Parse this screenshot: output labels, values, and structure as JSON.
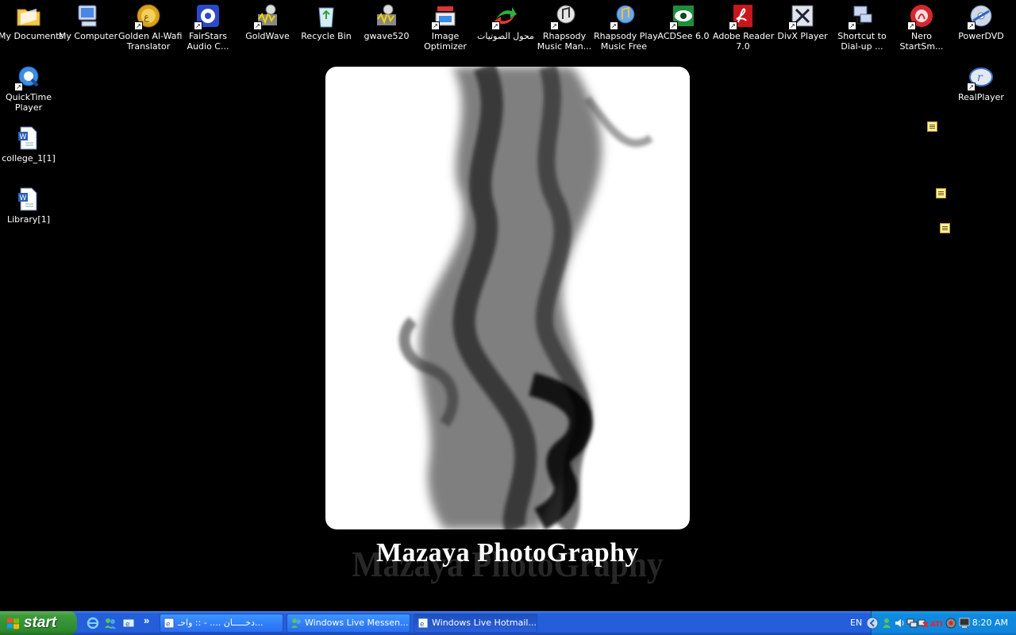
{
  "desktop": {
    "icons_top": [
      {
        "name": "my-documents",
        "l1": "My Documents",
        "l2": ""
      },
      {
        "name": "my-computer",
        "l1": "My Computer",
        "l2": ""
      },
      {
        "name": "golden-al-wafi",
        "l1": "Golden Al-Wafi",
        "l2": "Translator"
      },
      {
        "name": "fairstars",
        "l1": "FairStars",
        "l2": "Audio C..."
      },
      {
        "name": "goldwave",
        "l1": "GoldWave",
        "l2": ""
      },
      {
        "name": "recycle-bin",
        "l1": "Recycle Bin",
        "l2": ""
      },
      {
        "name": "gwave520",
        "l1": "gwave520",
        "l2": ""
      },
      {
        "name": "image-optimizer",
        "l1": "Image",
        "l2": "Optimizer"
      },
      {
        "name": "arabic-converter",
        "l1": "محول الصوتيات",
        "l2": ""
      },
      {
        "name": "rhapsody-music-manager",
        "l1": "Rhapsody",
        "l2": "Music Man..."
      },
      {
        "name": "rhapsody-play",
        "l1": "Rhapsody Play",
        "l2": "Music Free"
      },
      {
        "name": "acdsee",
        "l1": "ACDSee 6.0",
        "l2": ""
      },
      {
        "name": "adobe-reader",
        "l1": "Adobe Reader",
        "l2": "7.0"
      },
      {
        "name": "divx-player",
        "l1": "DivX Player",
        "l2": ""
      },
      {
        "name": "dialup-shortcut",
        "l1": "Shortcut to",
        "l2": "Dial-up ..."
      },
      {
        "name": "nero",
        "l1": "Nero",
        "l2": "StartSm..."
      },
      {
        "name": "powerdvd",
        "l1": "PowerDVD",
        "l2": ""
      }
    ],
    "icons_left": [
      {
        "name": "quicktime-player",
        "l1": "QuickTime",
        "l2": "Player"
      },
      {
        "name": "college-doc",
        "l1": "college_1[1]",
        "l2": ""
      },
      {
        "name": "library-doc",
        "l1": "Library[1]",
        "l2": ""
      }
    ],
    "icons_right": [
      {
        "name": "realplayer",
        "l1": "RealPlayer",
        "l2": ""
      }
    ]
  },
  "wallpaper": {
    "title": "Mazaya PhotoGraphy",
    "reflection": "Mazaya PhotoGraphy"
  },
  "taskbar": {
    "start_label": "start",
    "chevron": "»",
    "tasks": [
      {
        "label": "دخـــــان .... - :: واحـ..."
      },
      {
        "label": "Windows Live Messen..."
      },
      {
        "label": "Windows Live Hotmail..."
      }
    ],
    "lang": "EN",
    "clock": "8:20 AM"
  },
  "colors": {
    "desktop": "#000000",
    "taskbar": "#245edb",
    "start": "#3c9a3c",
    "tray": "#0f86dc"
  }
}
